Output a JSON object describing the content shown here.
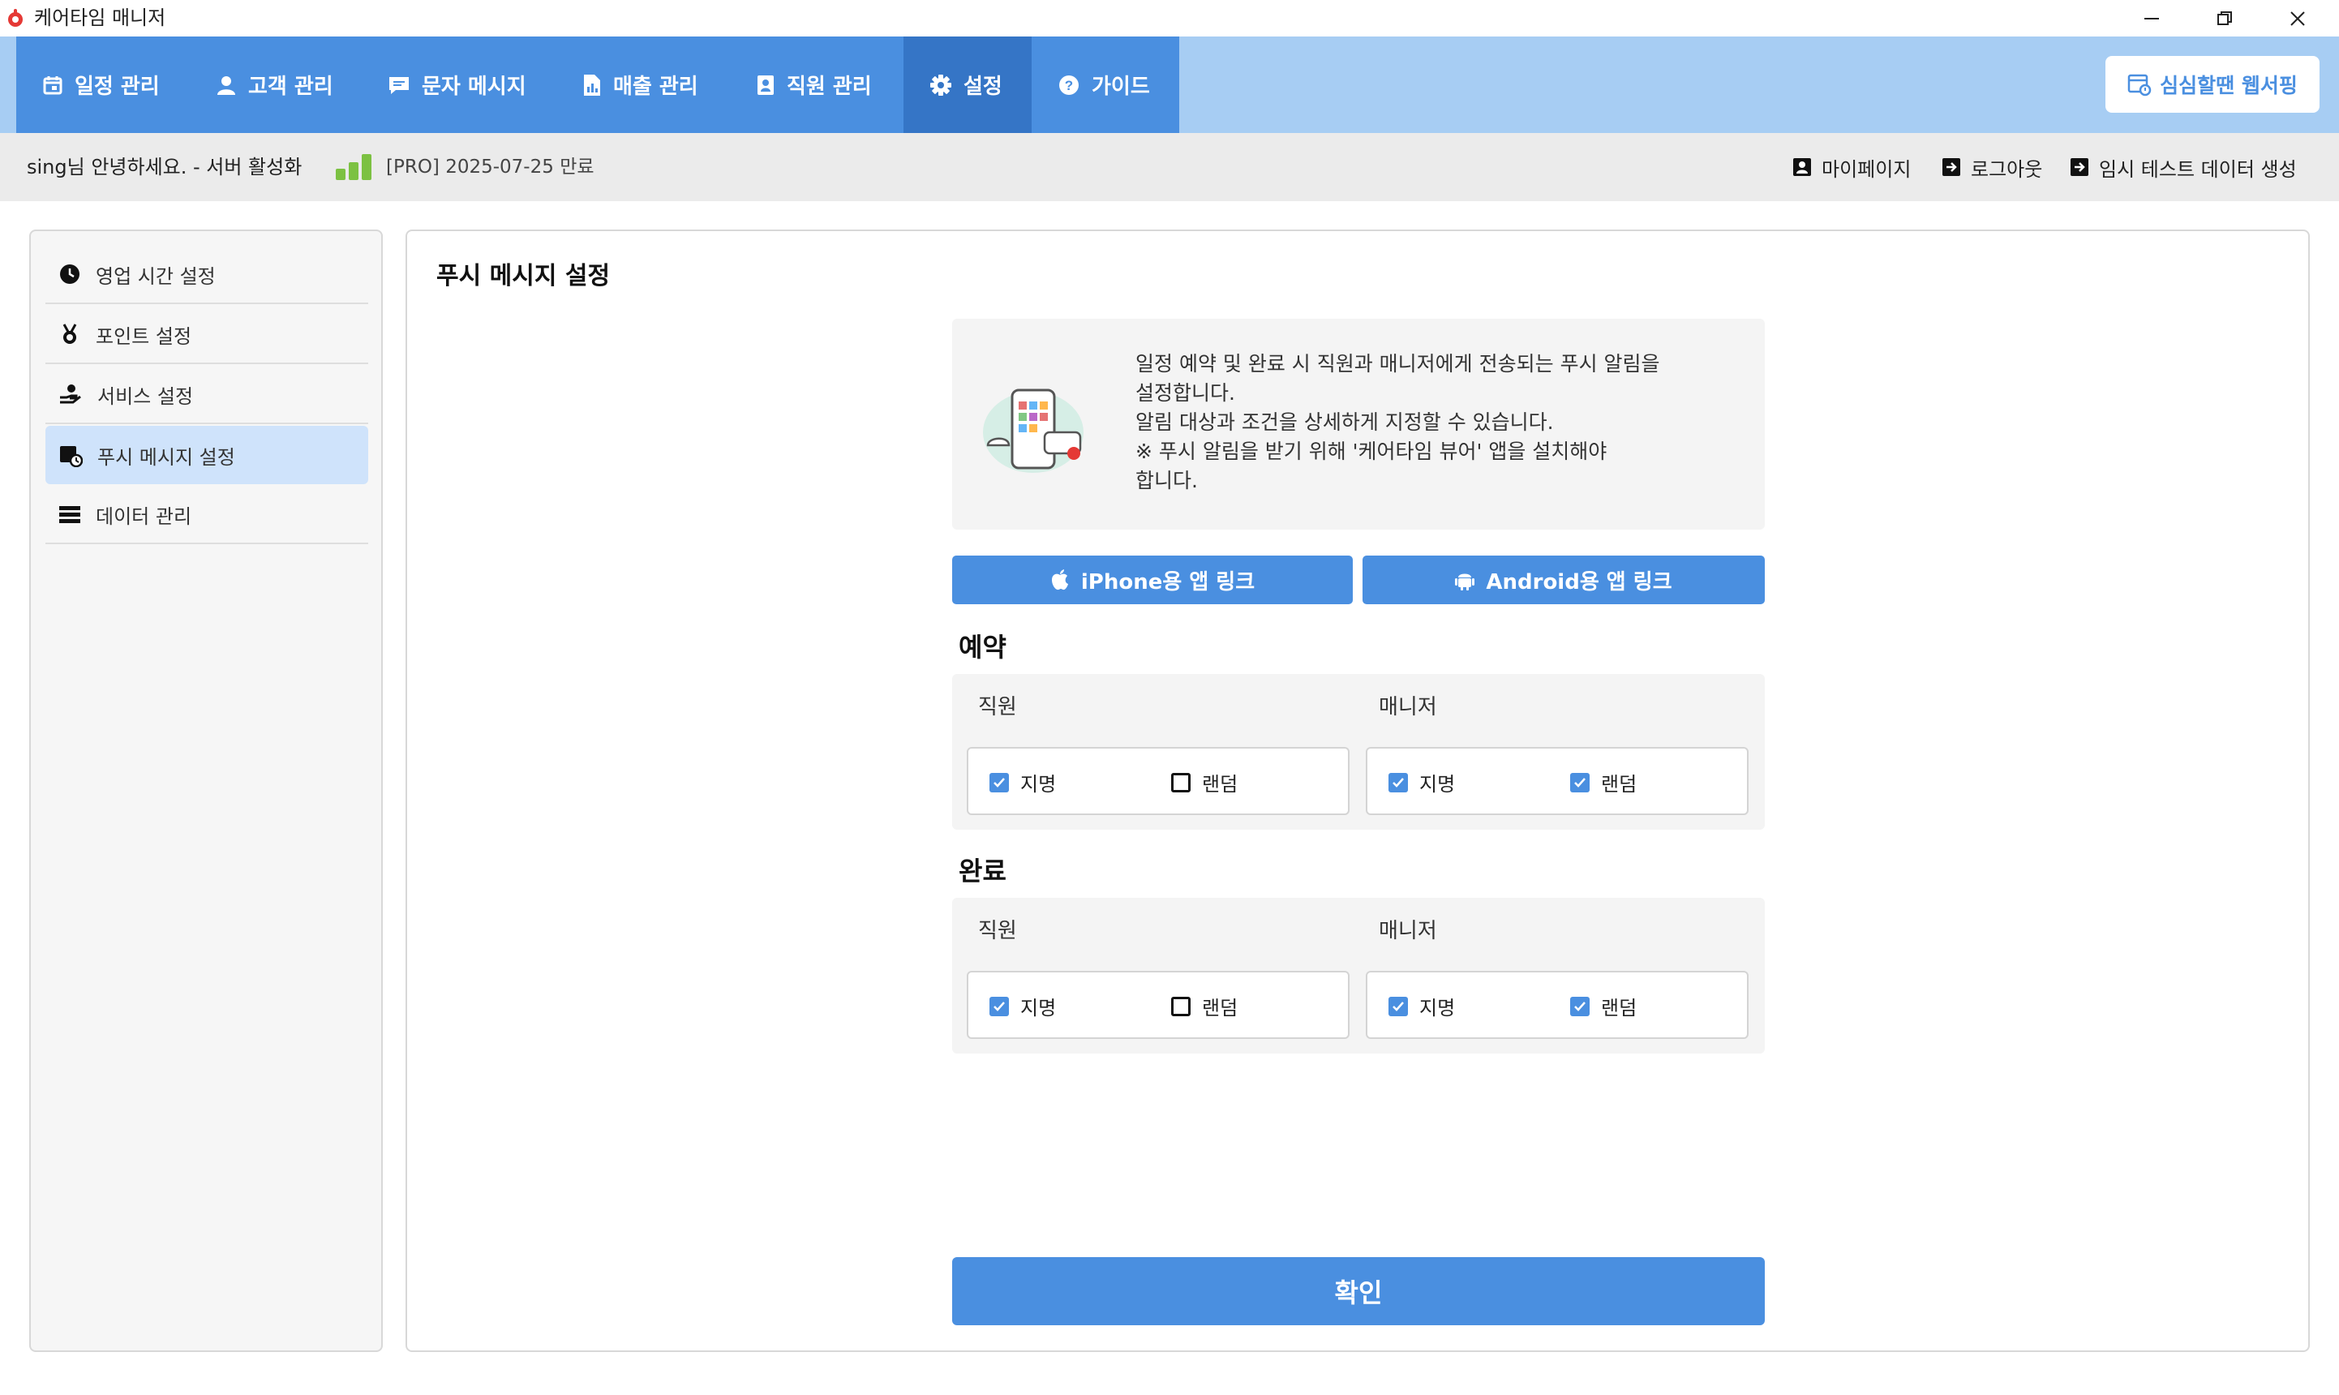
{
  "window": {
    "title": "케어타임 매니저",
    "controls": [
      "minimize-icon",
      "restore-icon",
      "close-icon"
    ]
  },
  "nav": {
    "tabs": [
      {
        "label": "일정 관리",
        "icon": "calendar-icon"
      },
      {
        "label": "고객 관리",
        "icon": "person-icon"
      },
      {
        "label": "문자 메시지",
        "icon": "message-icon"
      },
      {
        "label": "매출 관리",
        "icon": "document-chart-icon"
      },
      {
        "label": "직원 관리",
        "icon": "id-badge-icon"
      },
      {
        "label": "설정",
        "icon": "gear-icon",
        "active": true
      },
      {
        "label": "가이드",
        "icon": "question-circle-icon"
      }
    ],
    "web_button": "심심할땐 웹서핑"
  },
  "status": {
    "greeting": "sing님 안녕하세요. - 서버 활성화",
    "plan": "[PRO] 2025-07-25 만료",
    "links": [
      "마이페이지",
      "로그아웃",
      "임시 테스트 데이터 생성"
    ]
  },
  "sidebar": {
    "items": [
      {
        "label": "영업 시간 설정",
        "icon": "clock-icon"
      },
      {
        "label": "포인트 설정",
        "icon": "medal-icon"
      },
      {
        "label": "서비스 설정",
        "icon": "hand-service-icon"
      },
      {
        "label": "푸시 메시지 설정",
        "icon": "calendar-clock-icon",
        "active": true
      },
      {
        "label": "데이터 관리",
        "icon": "list-icon"
      }
    ]
  },
  "main": {
    "title": "푸시 메시지 설정",
    "info": {
      "line1": "일정 예약 및 완료 시 직원과 매니저에게 전송되는 푸시 알림을",
      "line2": "설정합니다.",
      "line3": "알림 대상과 조건을 상세하게 지정할 수 있습니다.",
      "line4": "※ 푸시 알림을 받기 위해 '케어타임 뷰어' 앱을 설치해야",
      "line5": "합니다."
    },
    "iphone_button": "iPhone용 앱 링크",
    "android_button": "Android용 앱 링크",
    "sections": [
      {
        "title": "예약",
        "staff_label": "직원",
        "manager_label": "매니저",
        "staff": {
          "named": {
            "label": "지명",
            "checked": true
          },
          "random": {
            "label": "랜덤",
            "checked": false
          }
        },
        "manager": {
          "named": {
            "label": "지명",
            "checked": true
          },
          "random": {
            "label": "랜덤",
            "checked": true
          }
        }
      },
      {
        "title": "완료",
        "staff_label": "직원",
        "manager_label": "매니저",
        "staff": {
          "named": {
            "label": "지명",
            "checked": true
          },
          "random": {
            "label": "랜덤",
            "checked": false
          }
        },
        "manager": {
          "named": {
            "label": "지명",
            "checked": true
          },
          "random": {
            "label": "랜덤",
            "checked": true
          }
        }
      }
    ],
    "confirm_button": "확인"
  },
  "colors": {
    "primary": "#4a8fe0",
    "nav_light": "#a7cdf3",
    "active_tab": "#3575c6",
    "sidebar_active": "#cfe3fb",
    "signal_green": "#7cc142"
  }
}
